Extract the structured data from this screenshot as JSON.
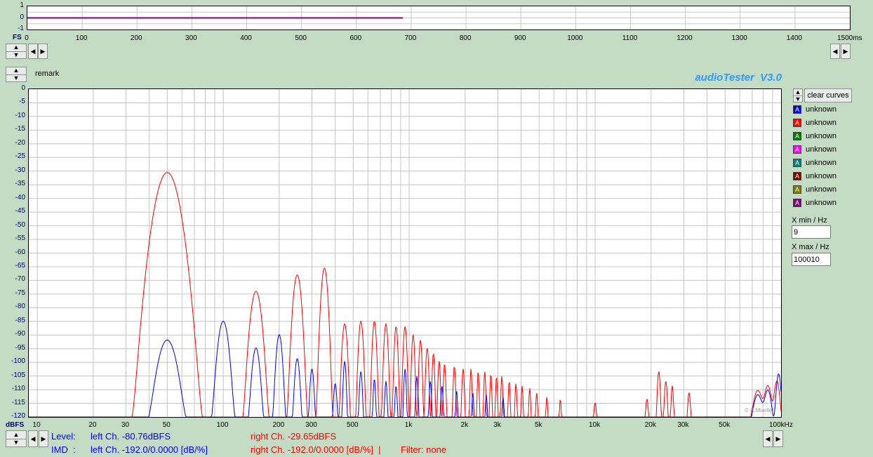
{
  "app": {
    "title": "audioTester  V3.0"
  },
  "remark": {
    "label": "remark"
  },
  "time_plot": {
    "y_unit": "FS",
    "x_unit": "1500ms",
    "y_ticks": [
      "1",
      "0",
      "-1"
    ],
    "x_ticks": [
      "0",
      "100",
      "200",
      "300",
      "400",
      "500",
      "600",
      "700",
      "800",
      "900",
      "1000",
      "1100",
      "1200",
      "1300",
      "1400"
    ]
  },
  "spectrum": {
    "y_unit": "dBFS",
    "x_unit": "100kHz",
    "y_ticks": [
      "0",
      "-5",
      "-10",
      "-15",
      "-20",
      "-25",
      "-30",
      "-35",
      "-40",
      "-45",
      "-50",
      "-55",
      "-60",
      "-65",
      "-70",
      "-75",
      "-80",
      "-85",
      "-90",
      "-95",
      "-100",
      "-105",
      "-110",
      "-115",
      "-120"
    ],
    "x_ticks": [
      "10",
      "20",
      "30",
      "50",
      "100",
      "200",
      "300",
      "500",
      "1k",
      "2k",
      "3k",
      "5k",
      "10k",
      "20k",
      "30k",
      "50k"
    ],
    "copyright": "© K.Mueller"
  },
  "legend": {
    "clear_button": "clear curves",
    "items": [
      {
        "label": "unknown",
        "color": "#0000ff",
        "glyph": "A"
      },
      {
        "label": "unknown",
        "color": "#ff0000",
        "glyph": "A"
      },
      {
        "label": "unknown",
        "color": "#008000",
        "glyph": "A"
      },
      {
        "label": "unknown",
        "color": "#ff00ff",
        "glyph": "A"
      },
      {
        "label": "unknown",
        "color": "#008080",
        "glyph": "A"
      },
      {
        "label": "unknown",
        "color": "#800000",
        "glyph": "A"
      },
      {
        "label": "unknown",
        "color": "#808000",
        "glyph": "A"
      },
      {
        "label": "unknown",
        "color": "#800080",
        "glyph": "A"
      }
    ]
  },
  "xrange": {
    "min_label": "X min / Hz",
    "min_value": "9",
    "max_label": "X max / Hz",
    "max_value": "100010"
  },
  "status": {
    "level_label": "Level:",
    "imd_label": "IMD  :",
    "level_left": "left Ch. -80.76dBFS",
    "level_right": "right Ch. -29.65dBFS",
    "imd_left": "left Ch. -192.0/0.0000 [dB/%]",
    "imd_right": "right Ch. -192.0/0.0000 [dB/%]  |",
    "filter": "Filter: none"
  },
  "chart_data": [
    {
      "type": "line",
      "xlabel": "ms",
      "ylabel": "FS",
      "xlim": [
        0,
        1500
      ],
      "ylim": [
        -1,
        1
      ],
      "grid": true,
      "series": [
        {
          "color": "#800080",
          "x": [
            0,
            685
          ],
          "y": [
            0,
            0
          ]
        }
      ]
    },
    {
      "type": "line",
      "xlabel": "kHz",
      "ylabel": "dBFS",
      "x_scale": "log",
      "xlim": [
        9,
        100010
      ],
      "ylim": [
        -120,
        0
      ],
      "grid": true,
      "series": [
        {
          "color": "#ff0000",
          "peaks": [
            [
              50,
              -30.5,
              0.04
            ],
            [
              150,
              -74,
              0.02
            ],
            [
              250,
              -68,
              0.015
            ],
            [
              350,
              -65.5,
              0.012
            ],
            [
              450,
              -86,
              0.01
            ],
            [
              550,
              -85,
              0.009
            ],
            [
              650,
              -85,
              0.008
            ],
            [
              750,
              -86,
              0.008
            ],
            [
              850,
              -87,
              0.007
            ],
            [
              950,
              -87,
              0.007
            ],
            [
              1050,
              -90,
              0.006
            ],
            [
              1150,
              -92,
              0.006
            ],
            [
              1250,
              -95,
              0.006
            ],
            [
              1350,
              -97,
              0.005
            ],
            [
              1450,
              -100,
              0.005
            ],
            [
              1550,
              -101,
              0.005
            ],
            [
              1750,
              -102,
              0.005
            ],
            [
              1950,
              -103,
              0.005
            ],
            [
              2150,
              -103,
              0.004
            ],
            [
              2350,
              -104,
              0.004
            ],
            [
              2550,
              -104,
              0.004
            ],
            [
              2750,
              -105,
              0.004
            ],
            [
              2950,
              -106,
              0.004
            ],
            [
              3150,
              -106,
              0.004
            ],
            [
              3450,
              -108,
              0.004
            ],
            [
              3750,
              -109,
              0.004
            ],
            [
              4050,
              -110,
              0.004
            ],
            [
              4450,
              -111,
              0.004
            ],
            [
              4850,
              -113,
              0.004
            ],
            [
              5500,
              -115,
              0.004
            ],
            [
              6500,
              -116,
              0.004
            ],
            [
              10000,
              -118,
              0.006
            ],
            [
              19000,
              -116,
              0.006
            ],
            [
              22000,
              -104,
              0.006
            ],
            [
              24000,
              -108,
              0.006
            ],
            [
              26000,
              -110,
              0.005
            ],
            [
              32000,
              -113,
              0.006
            ],
            [
              75000,
              -112,
              0.02
            ],
            [
              85000,
              -110,
              0.015
            ],
            [
              95000,
              -108,
              0.012
            ]
          ]
        },
        {
          "color": "#0000ff",
          "peaks": [
            [
              50,
              -92,
              0.035
            ],
            [
              100,
              -85,
              0.02
            ],
            [
              150,
              -95,
              0.015
            ],
            [
              200,
              -90,
              0.012
            ],
            [
              250,
              -99,
              0.01
            ],
            [
              300,
              -103,
              0.008
            ],
            [
              400,
              -109,
              0.007
            ],
            [
              450,
              -100,
              0.006
            ],
            [
              550,
              -104,
              0.006
            ],
            [
              650,
              -107,
              0.005
            ],
            [
              750,
              -108,
              0.005
            ],
            [
              850,
              -110,
              0.005
            ],
            [
              950,
              -103,
              0.005
            ],
            [
              1100,
              -106,
              0.005
            ],
            [
              1300,
              -108,
              0.005
            ],
            [
              1500,
              -110,
              0.005
            ],
            [
              1800,
              -112,
              0.004
            ],
            [
              2200,
              -113,
              0.004
            ],
            [
              2600,
              -114,
              0.004
            ],
            [
              3200,
              -115,
              0.004
            ],
            [
              75000,
              -114,
              0.02
            ],
            [
              85000,
              -112,
              0.015
            ],
            [
              97000,
              -105,
              0.01
            ]
          ]
        }
      ]
    }
  ]
}
